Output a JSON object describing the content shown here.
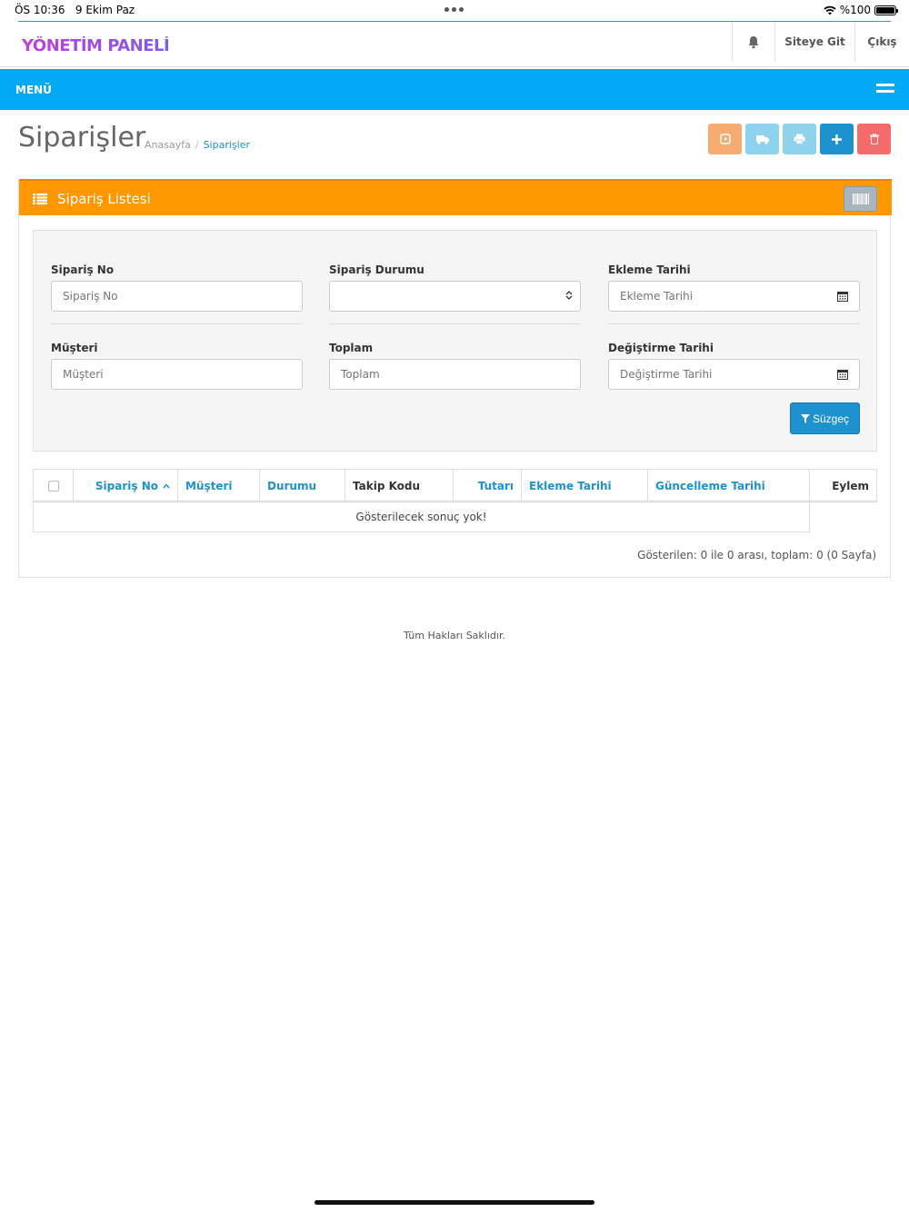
{
  "statusbar": {
    "time": "ÖS 10:36",
    "date": "9 Ekim Paz",
    "battery": "%100"
  },
  "header": {
    "logo": "YÖNETİM PANELİ",
    "notifications_icon": "bell-icon",
    "site_link": "Siteye Git",
    "logout": "Çıkış"
  },
  "menu": {
    "label": "MENÜ",
    "toggle_icon": "hamburger-icon"
  },
  "page": {
    "title": "Siparişler",
    "breadcrumb": [
      "Anasayfa",
      "Siparişler"
    ],
    "actions": [
      {
        "name": "invoice-button",
        "icon": "play-square-icon",
        "color": "#f6ab71"
      },
      {
        "name": "shipping-button",
        "icon": "truck-icon",
        "color": "#8ed2ee"
      },
      {
        "name": "print-button",
        "icon": "print-icon",
        "color": "#8ed2ee"
      },
      {
        "name": "add-button",
        "icon": "plus-icon",
        "color": "#1e91cf"
      },
      {
        "name": "delete-button",
        "icon": "trash-icon",
        "color": "#f56b6b"
      }
    ]
  },
  "panel": {
    "title": "Sipariş Listesi",
    "title_icon": "list-icon",
    "barcode_icon": "barcode-icon",
    "header_color": "#ff9800"
  },
  "filter": {
    "order_no": {
      "label": "Sipariş No",
      "placeholder": "Sipariş No"
    },
    "order_status": {
      "label": "Sipariş Durumu",
      "value": ""
    },
    "date_added": {
      "label": "Ekleme Tarihi",
      "placeholder": "Ekleme Tarihi"
    },
    "customer": {
      "label": "Müşteri",
      "placeholder": "Müşteri"
    },
    "total": {
      "label": "Toplam",
      "placeholder": "Toplam"
    },
    "date_modified": {
      "label": "Değiştirme Tarihi",
      "placeholder": "Değiştirme Tarihi"
    },
    "filter_button": "Süzgeç"
  },
  "table": {
    "columns": [
      "Sipariş No",
      "Müşteri",
      "Durumu",
      "Takip Kodu",
      "Tutarı",
      "Ekleme Tarihi",
      "Güncelleme Tarihi",
      "Eylem"
    ],
    "empty_text": "Gösterilecek sonuç yok!",
    "pagination_info": "Gösterilen: 0 ile 0 arası, toplam: 0 (0 Sayfa)"
  },
  "footer": {
    "text": "Tüm Hakları Saklıdır."
  },
  "colors": {
    "primary": "#1e91cf",
    "menu_bar": "#03a9f4",
    "warning": "#ff9800",
    "danger": "#f56b6b"
  }
}
